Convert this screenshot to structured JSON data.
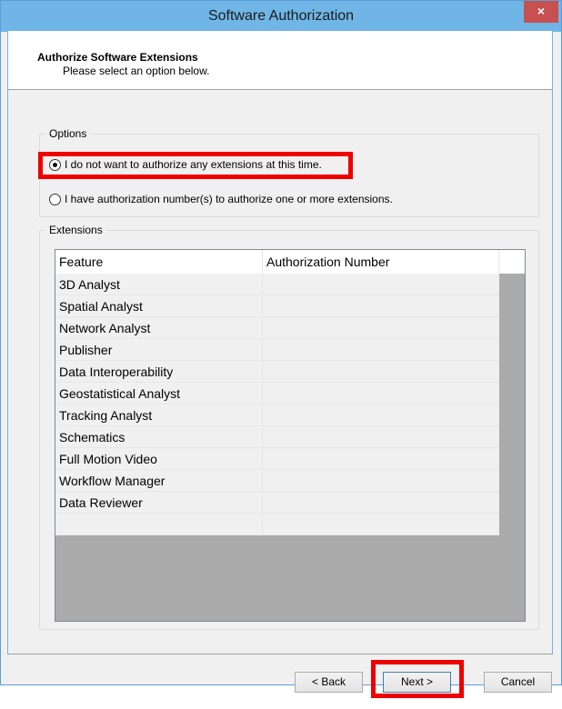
{
  "window": {
    "title": "Software Authorization",
    "close_label": "×"
  },
  "header": {
    "title": "Authorize Software Extensions",
    "subtitle": "Please select an option below."
  },
  "options": {
    "group_label": "Options",
    "items": [
      {
        "label": "I do not want to authorize any extensions at this time.",
        "checked": true
      },
      {
        "label": "I have authorization number(s) to authorize one or more extensions.",
        "checked": false
      }
    ]
  },
  "extensions": {
    "group_label": "Extensions",
    "columns": [
      "Feature",
      "Authorization Number"
    ],
    "rows": [
      {
        "feature": "3D Analyst",
        "auth": ""
      },
      {
        "feature": "Spatial Analyst",
        "auth": ""
      },
      {
        "feature": "Network Analyst",
        "auth": ""
      },
      {
        "feature": "Publisher",
        "auth": ""
      },
      {
        "feature": "Data Interoperability",
        "auth": ""
      },
      {
        "feature": "Geostatistical Analyst",
        "auth": ""
      },
      {
        "feature": "Tracking Analyst",
        "auth": ""
      },
      {
        "feature": "Schematics",
        "auth": ""
      },
      {
        "feature": "Full Motion Video",
        "auth": ""
      },
      {
        "feature": "Workflow Manager",
        "auth": ""
      },
      {
        "feature": "Data Reviewer",
        "auth": ""
      },
      {
        "feature": "",
        "auth": ""
      }
    ]
  },
  "buttons": {
    "back": "< Back",
    "next": "Next >",
    "cancel": "Cancel"
  },
  "colors": {
    "titlebar": "#6fb6e6",
    "highlight": "#ee0000",
    "close": "#c75050"
  }
}
